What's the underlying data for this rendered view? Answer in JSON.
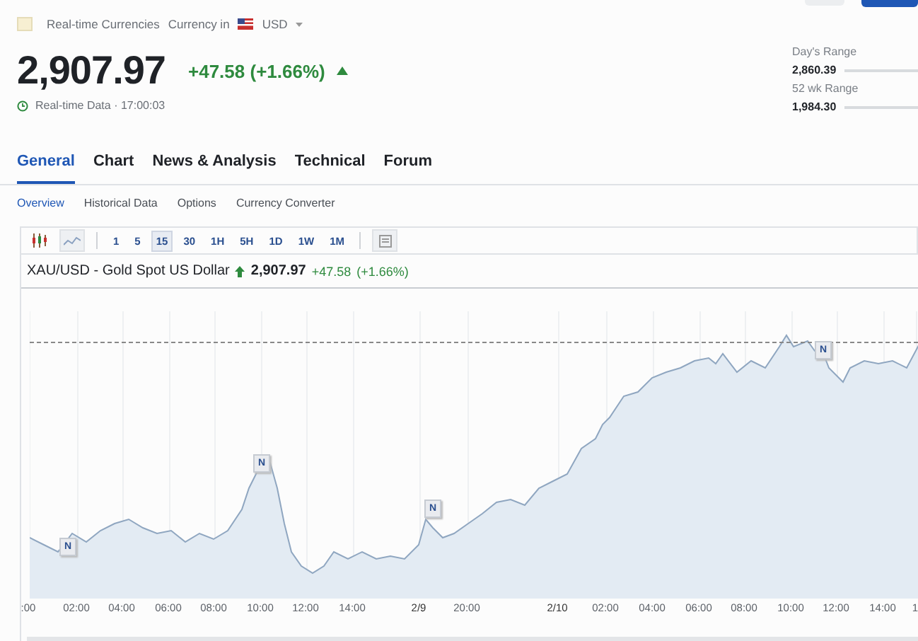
{
  "header": {
    "category": "Real-time Currencies",
    "currency_label": "Currency in",
    "currency": "USD"
  },
  "quote": {
    "price": "2,907.97",
    "change": "+47.58 (+1.66%)",
    "rising": true,
    "status": "Real-time Data · 17:00:03"
  },
  "ranges": [
    {
      "label": "Day's Range",
      "low": "2,860.39"
    },
    {
      "label": "52 wk Range",
      "low": "1,984.30"
    }
  ],
  "tabs": [
    {
      "label": "General",
      "selected": true
    },
    {
      "label": "Chart",
      "selected": false
    },
    {
      "label": "News & Analysis",
      "selected": false
    },
    {
      "label": "Technical",
      "selected": false
    },
    {
      "label": "Forum",
      "selected": false
    }
  ],
  "subtabs": [
    {
      "label": "Overview",
      "selected": true
    },
    {
      "label": "Historical Data",
      "selected": false
    },
    {
      "label": "Options",
      "selected": false
    },
    {
      "label": "Currency Converter",
      "selected": false
    }
  ],
  "intervals": [
    {
      "label": "1",
      "selected": false
    },
    {
      "label": "5",
      "selected": false
    },
    {
      "label": "15",
      "selected": true
    },
    {
      "label": "30",
      "selected": false
    },
    {
      "label": "1H",
      "selected": false
    },
    {
      "label": "5H",
      "selected": false
    },
    {
      "label": "1D",
      "selected": false
    },
    {
      "label": "1W",
      "selected": false
    },
    {
      "label": "1M",
      "selected": false
    }
  ],
  "chart": {
    "title": "XAU/USD - Gold Spot US Dollar",
    "price": "2,907.97",
    "change": "+47.58",
    "change_pct": "(+1.66%)",
    "news_markers": [
      {
        "label": "N"
      },
      {
        "label": "N"
      },
      {
        "label": "N"
      },
      {
        "label": "N"
      }
    ],
    "x_labels": [
      {
        "label": ":00",
        "kind": "time"
      },
      {
        "label": "02:00",
        "kind": "time"
      },
      {
        "label": "04:00",
        "kind": "time"
      },
      {
        "label": "06:00",
        "kind": "time"
      },
      {
        "label": "08:00",
        "kind": "time"
      },
      {
        "label": "10:00",
        "kind": "time"
      },
      {
        "label": "12:00",
        "kind": "time"
      },
      {
        "label": "14:00",
        "kind": "time"
      },
      {
        "label": "2/9",
        "kind": "date"
      },
      {
        "label": "20:00",
        "kind": "time"
      },
      {
        "label": "2/10",
        "kind": "date"
      },
      {
        "label": "02:00",
        "kind": "time"
      },
      {
        "label": "04:00",
        "kind": "time"
      },
      {
        "label": "06:00",
        "kind": "time"
      },
      {
        "label": "08:00",
        "kind": "time"
      },
      {
        "label": "10:00",
        "kind": "time"
      },
      {
        "label": "12:00",
        "kind": "time"
      },
      {
        "label": "14:00",
        "kind": "time"
      },
      {
        "label": "1",
        "kind": "time"
      }
    ]
  }
}
